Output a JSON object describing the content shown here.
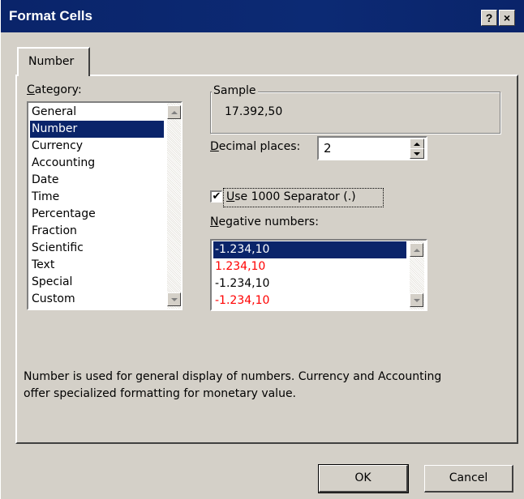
{
  "window": {
    "title": "Format Cells",
    "help_label": "?",
    "close_label": "×"
  },
  "tabs": [
    {
      "label": "Number",
      "active": true
    }
  ],
  "category": {
    "label_ul": "C",
    "label_rest": "ategory:",
    "items": [
      "General",
      "Number",
      "Currency",
      "Accounting",
      "Date",
      "Time",
      "Percentage",
      "Fraction",
      "Scientific",
      "Text",
      "Special",
      "Custom"
    ],
    "selected": "Number"
  },
  "sample": {
    "label": "Sample",
    "value": "17.392,50"
  },
  "decimal_places": {
    "label_ul": "D",
    "label_rest": "ecimal places:",
    "value": "2"
  },
  "separator": {
    "checked": true,
    "check_glyph": "✔",
    "label_ul": "U",
    "label_rest": "se 1000 Separator (.)"
  },
  "negative_numbers": {
    "label_ul": "N",
    "label_rest": "egative numbers:",
    "items": [
      {
        "text": "-1.234,10",
        "color": "#000000",
        "selected": true
      },
      {
        "text": "1.234,10",
        "color": "#ff0000",
        "selected": false
      },
      {
        "text": "-1.234,10",
        "color": "#000000",
        "selected": false
      },
      {
        "text": "-1.234,10",
        "color": "#ff0000",
        "selected": false
      }
    ]
  },
  "description": {
    "line1": "Number is used for general display of numbers.  Currency and Accounting",
    "line2": "offer specialized formatting for monetary value."
  },
  "buttons": {
    "ok": "OK",
    "cancel": "Cancel"
  }
}
